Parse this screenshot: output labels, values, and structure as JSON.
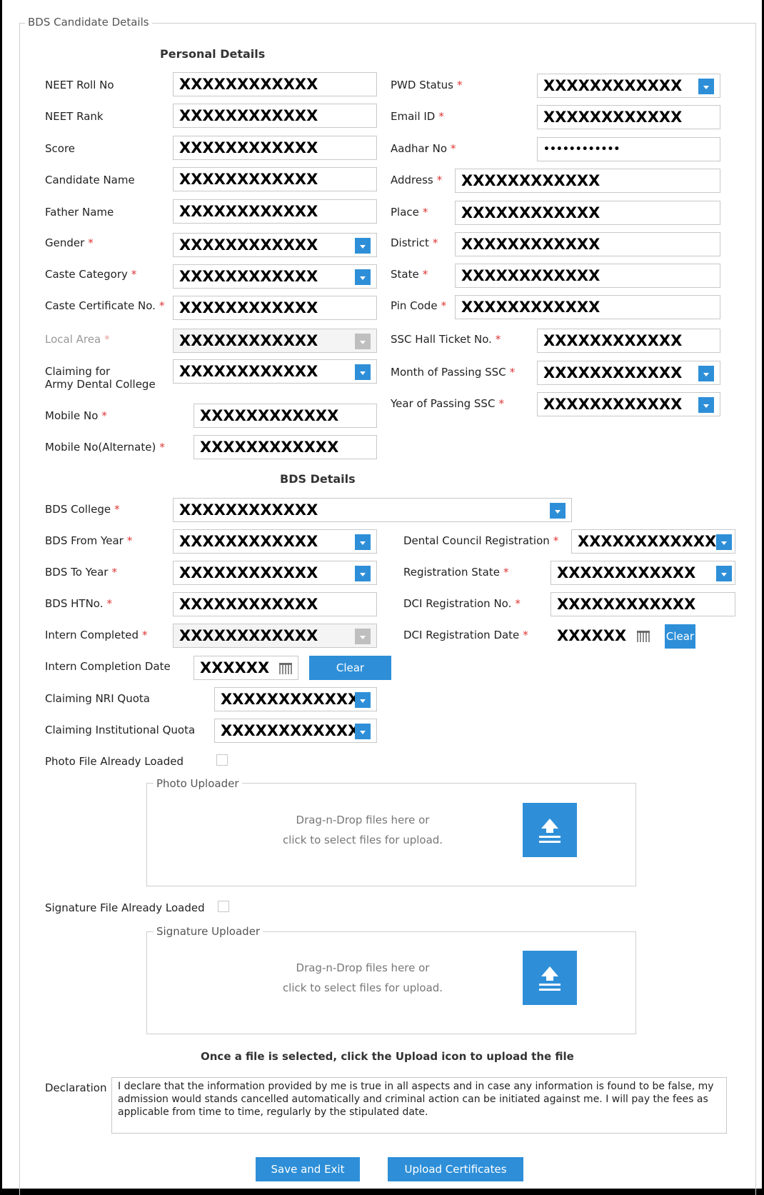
{
  "legend": "BDS Candidate Details",
  "personal_title": "Personal Details",
  "bds_title": "BDS Details",
  "mask": "XXXXXXXXXXXX",
  "mask_short": "XXXXXX",
  "aadhar_value": "••••••••••••",
  "required_mark": "*",
  "fields": {
    "neet_roll_no": "NEET Roll No",
    "neet_rank": "NEET Rank",
    "score": "Score",
    "candidate_name": "Candidate Name",
    "father_name": "Father Name",
    "gender": "Gender",
    "caste_category": "Caste Category",
    "caste_certificate_no": "Caste Certificate No.",
    "local_area": "Local Area",
    "claiming_army_line1": "Claiming for",
    "claiming_army_line2": "Army Dental College",
    "mobile_no": "Mobile No",
    "mobile_alt": "Mobile No(Alternate)",
    "pwd_status": "PWD Status",
    "email_id": "Email ID",
    "aadhar_no": "Aadhar No",
    "address": "Address",
    "place": "Place",
    "district": "District",
    "state": "State",
    "pin_code": "Pin Code",
    "ssc_hall_ticket": "SSC Hall Ticket No.",
    "month_passing_ssc": "Month of Passing SSC",
    "year_passing_ssc": "Year of Passing SSC",
    "bds_college": "BDS College",
    "bds_from_year": "BDS From Year",
    "bds_to_year": "BDS To Year",
    "bds_htno": "BDS HTNo.",
    "intern_completed": "Intern Completed",
    "intern_completion_date": "Intern Completion Date",
    "claiming_nri": "Claiming NRI Quota",
    "claiming_institutional": "Claiming Institutional Quota",
    "photo_loaded": "Photo File Already Loaded",
    "signature_loaded": "Signature File Already Loaded",
    "dental_council_reg": "Dental Council Registration",
    "registration_state": "Registration State",
    "dci_reg_no": "DCI Registration No.",
    "dci_reg_date": "DCI Registration Date"
  },
  "buttons": {
    "clear": "Clear",
    "save_exit": "Save and Exit",
    "upload_certificates": "Upload Certificates"
  },
  "photo_uploader": {
    "legend": "Photo Uploader",
    "line1": "Drag-n-Drop files here or",
    "line2": "click to select files for upload."
  },
  "signature_uploader": {
    "legend": "Signature Uploader",
    "line1": "Drag-n-Drop files here or",
    "line2": "click to select files for upload."
  },
  "upload_note": "Once a file is selected, click the Upload icon to upload the file",
  "declaration_label": "Declaration",
  "declaration_text": "I declare that the information provided by me is true in all aspects and in case any information is found to be false, my admission would stands cancelled automatically and criminal action can be initiated against me. I will pay the fees as applicable from time to time, regularly by the stipulated date.",
  "colors": {
    "accent": "#2e8fd8",
    "required": "#e03535"
  }
}
